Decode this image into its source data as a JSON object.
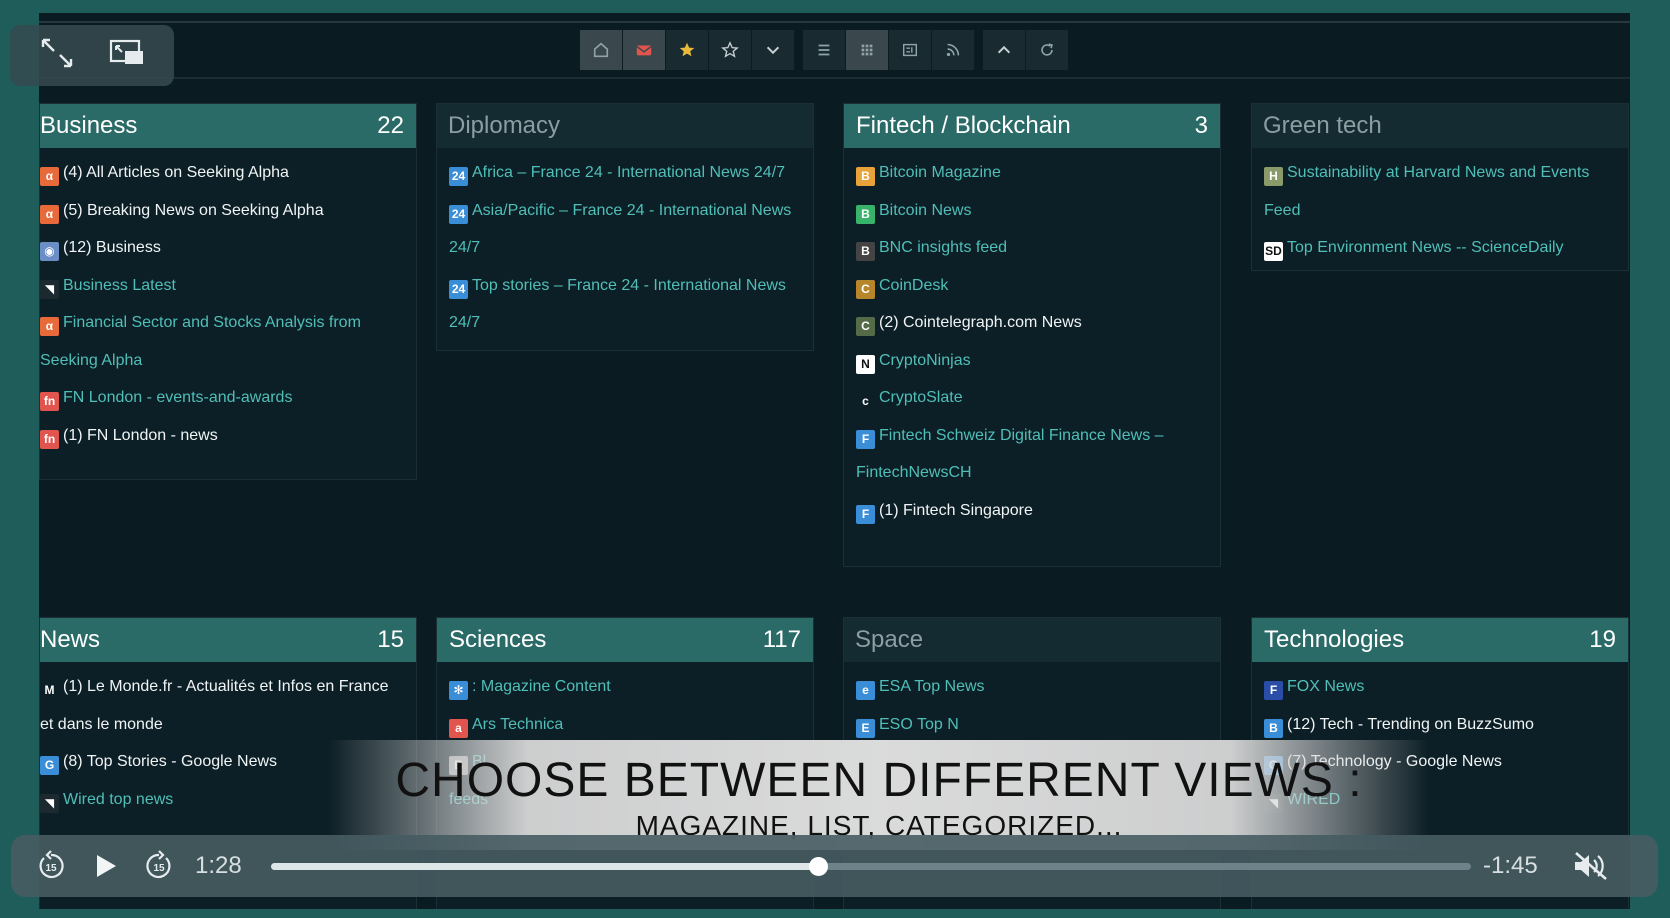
{
  "player": {
    "elapsed": "1:28",
    "remaining": "-1:45",
    "progress": 0.456
  },
  "overlay": {
    "title": "CHOOSE BETWEEN DIFFERENT VIEWS :",
    "subtitle": "MAGAZINE, LIST, CATEGORIZED..."
  },
  "toolbar": {
    "icons": [
      "home-icon",
      "mail-icon",
      "star-filled-icon",
      "star-outline-icon",
      "chevron-down-icon",
      "list-view-icon",
      "grid-view-icon",
      "card-view-icon",
      "rss-icon",
      "chevron-up-icon",
      "refresh-icon"
    ]
  },
  "panels": [
    {
      "title": "Business",
      "count": "22",
      "active": true,
      "items": [
        {
          "label": "(4) All Articles on Seeking Alpha",
          "unread": true,
          "icon": "α",
          "color": "#e86a3a"
        },
        {
          "label": "(5) Breaking News on Seeking Alpha",
          "unread": true,
          "icon": "α",
          "color": "#e86a3a"
        },
        {
          "label": "(12) Business",
          "unread": true,
          "icon": "◉",
          "color": "#6b8ec7"
        },
        {
          "label": "Business Latest",
          "unread": false,
          "icon": "◥",
          "color": "#1c2a30"
        },
        {
          "label": "Financial Sector and Stocks Analysis from",
          "cont": "Seeking Alpha",
          "unread": false,
          "icon": "α",
          "color": "#e86a3a"
        },
        {
          "label": "FN London - events-and-awards",
          "unread": false,
          "icon": "fn",
          "color": "#e2554e"
        },
        {
          "label": "(1) FN London - news",
          "unread": true,
          "icon": "fn",
          "color": "#e2554e"
        }
      ]
    },
    {
      "title": "Diplomacy",
      "count": "",
      "active": false,
      "items": [
        {
          "label": "Africa – France 24 - International News 24/7",
          "unread": false,
          "icon": "24",
          "color": "#3a8ed8"
        },
        {
          "label": "Asia/Pacific – France 24 - International News",
          "cont": "24/7",
          "unread": false,
          "icon": "24",
          "color": "#3a8ed8"
        },
        {
          "label": "Top stories – France 24 - International News",
          "cont": "24/7",
          "unread": false,
          "icon": "24",
          "color": "#3a8ed8"
        }
      ]
    },
    {
      "title": "Fintech / Blockchain",
      "count": "3",
      "active": true,
      "items": [
        {
          "label": "Bitcoin Magazine",
          "unread": false,
          "icon": "B",
          "color": "#e8a23a"
        },
        {
          "label": "Bitcoin News",
          "unread": false,
          "icon": "B",
          "color": "#3ab36a"
        },
        {
          "label": "BNC insights feed",
          "unread": false,
          "icon": "B",
          "color": "#444"
        },
        {
          "label": "CoinDesk",
          "unread": false,
          "icon": "C",
          "color": "#b8862a"
        },
        {
          "label": "(2) Cointelegraph.com News",
          "unread": true,
          "icon": "C",
          "color": "#556b48"
        },
        {
          "label": "CryptoNinjas",
          "unread": false,
          "icon": "N",
          "color": "#ffffff"
        },
        {
          "label": "CryptoSlate",
          "unread": false,
          "icon": "c",
          "color": "#0d1f26"
        },
        {
          "label": "Fintech Schweiz Digital Finance News –",
          "cont": "FintechNewsCH",
          "unread": false,
          "icon": "F",
          "color": "#3a8ed8"
        },
        {
          "label": "(1) Fintech Singapore",
          "unread": true,
          "icon": "F",
          "color": "#3a8ed8"
        }
      ]
    },
    {
      "title": "Green tech",
      "count": "",
      "active": false,
      "items": [
        {
          "label": "Sustainability at Harvard News and Events",
          "cont": "Feed",
          "unread": false,
          "icon": "H",
          "color": "#8a9a6a"
        },
        {
          "label": "Top Environment News -- ScienceDaily",
          "unread": false,
          "icon": "SD",
          "color": "#ffffff"
        }
      ]
    },
    {
      "title": "News",
      "count": "15",
      "active": true,
      "items": [
        {
          "label": "(1) Le Monde.fr - Actualités et Infos en France",
          "cont": "et dans le monde",
          "unread": true,
          "icon": "M",
          "color": "#0d1f26"
        },
        {
          "label": "(8) Top Stories - Google News",
          "unread": true,
          "icon": "G",
          "color": "#3a8ed8"
        },
        {
          "label": "Wired top news",
          "unread": false,
          "icon": "◥",
          "color": "#1c2a30"
        }
      ]
    },
    {
      "title": "Sciences",
      "count": "117",
      "active": true,
      "items": [
        {
          "label": ": Magazine Content",
          "unread": false,
          "icon": "✻",
          "color": "#3a8ed8"
        },
        {
          "label": "Ars Technica",
          "unread": false,
          "icon": "a",
          "color": "#e2554e"
        },
        {
          "label": "Bl",
          "cont": "feeds",
          "unread": false,
          "icon": "B",
          "color": "#aaa"
        }
      ]
    },
    {
      "title": "Space",
      "count": "",
      "active": false,
      "items": [
        {
          "label": "ESA Top News",
          "unread": false,
          "icon": "e",
          "color": "#3a8ed8"
        },
        {
          "label": "ESO Top N",
          "unread": false,
          "icon": "E",
          "color": "#3a8ed8"
        }
      ]
    },
    {
      "title": "Technologies",
      "count": "19",
      "active": true,
      "items": [
        {
          "label": "FOX News",
          "unread": false,
          "icon": "F",
          "color": "#2a4ea8"
        },
        {
          "label": "(12) Tech - Trending on BuzzSumo",
          "unread": true,
          "icon": "B",
          "color": "#3a8ed8"
        },
        {
          "label": "(7) Technology - Google News",
          "unread": true,
          "icon": "G",
          "color": "#3a8ed8"
        },
        {
          "label": "WIRED",
          "unread": false,
          "icon": "◥",
          "color": "#1c2a30"
        }
      ]
    }
  ]
}
